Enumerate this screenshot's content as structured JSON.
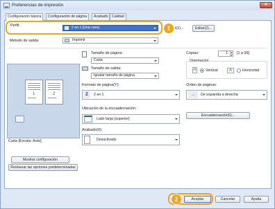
{
  "window": {
    "title": "Preferencias de impresión",
    "close_glyph": "✕"
  },
  "tabs": [
    {
      "label": "Configuración básica",
      "active": true
    },
    {
      "label": "Configuración de página",
      "active": false
    },
    {
      "label": "Acabado",
      "active": false
    },
    {
      "label": "Calidad",
      "active": false
    }
  ],
  "profile": {
    "label": "Perfil:",
    "value": "2 en 1 [Una cara]",
    "edit_partial": "t(1)...",
    "edit_button": "Editar(2)..."
  },
  "output_method": {
    "label": "Método de salida:",
    "value": "Imprimir"
  },
  "preview": {
    "page_numbers": [
      "1",
      "2"
    ],
    "caption": "Carta [Escala: Auto]"
  },
  "page_size": {
    "label": "Tamaño de página:",
    "value": "Carta"
  },
  "output_size": {
    "label": "Tamaño de salida:",
    "value": "Igualar tamaño de página"
  },
  "copies": {
    "label": "Copias:",
    "value": "1",
    "range": "[1 a 99]"
  },
  "orientation": {
    "label": "Orientación",
    "vertical": "Vertical",
    "horizontal": "Horizontal",
    "icon_letter": "A",
    "selected": "vertical"
  },
  "page_layout": {
    "label": "Formato de página(Y):",
    "value": "2 en 1",
    "icon_number": "2"
  },
  "page_order": {
    "label": "Orden de páginas:",
    "value": "De izquierda a derecha"
  },
  "binding": {
    "label": "Ubicación de la encuadernación:",
    "value": "Lado largo [superior]",
    "button": "Encuadernación(6)..."
  },
  "finishing": {
    "label": "Acabado(0):",
    "value": "Desactivado"
  },
  "bottom": {
    "show_settings": "Mostrar configuración",
    "restore_defaults": "Restaurar las opciones predeterminadas"
  },
  "footer": {
    "accept": "Aceptar",
    "cancel": "Cancelar",
    "help": "Ayuda"
  },
  "callouts": [
    "1",
    "2"
  ],
  "colors": {
    "highlight": "#f0a419",
    "selection": "#3f73d0"
  }
}
